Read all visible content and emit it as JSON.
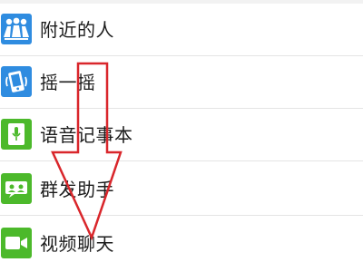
{
  "menu": {
    "items": [
      {
        "label": "附近的人",
        "icon": "people-nearby-icon",
        "icon_color": "#2f8ce0"
      },
      {
        "label": "摇一摇",
        "icon": "shake-phone-icon",
        "icon_color": "#2f8ce0"
      },
      {
        "label": "语音记事本",
        "icon": "voice-notepad-icon",
        "icon_color": "#4cb92b"
      },
      {
        "label": "群发助手",
        "icon": "broadcast-assistant-icon",
        "icon_color": "#4cb92b"
      },
      {
        "label": "视频聊天",
        "icon": "video-chat-icon",
        "icon_color": "#4cb92b"
      }
    ]
  },
  "overlay": {
    "arrow": "down-arrow-annotation",
    "arrow_color": "#d9262b"
  },
  "colors": {
    "background": "#ffffff",
    "divider": "#e4e4e4",
    "text": "#1c1c1c"
  }
}
